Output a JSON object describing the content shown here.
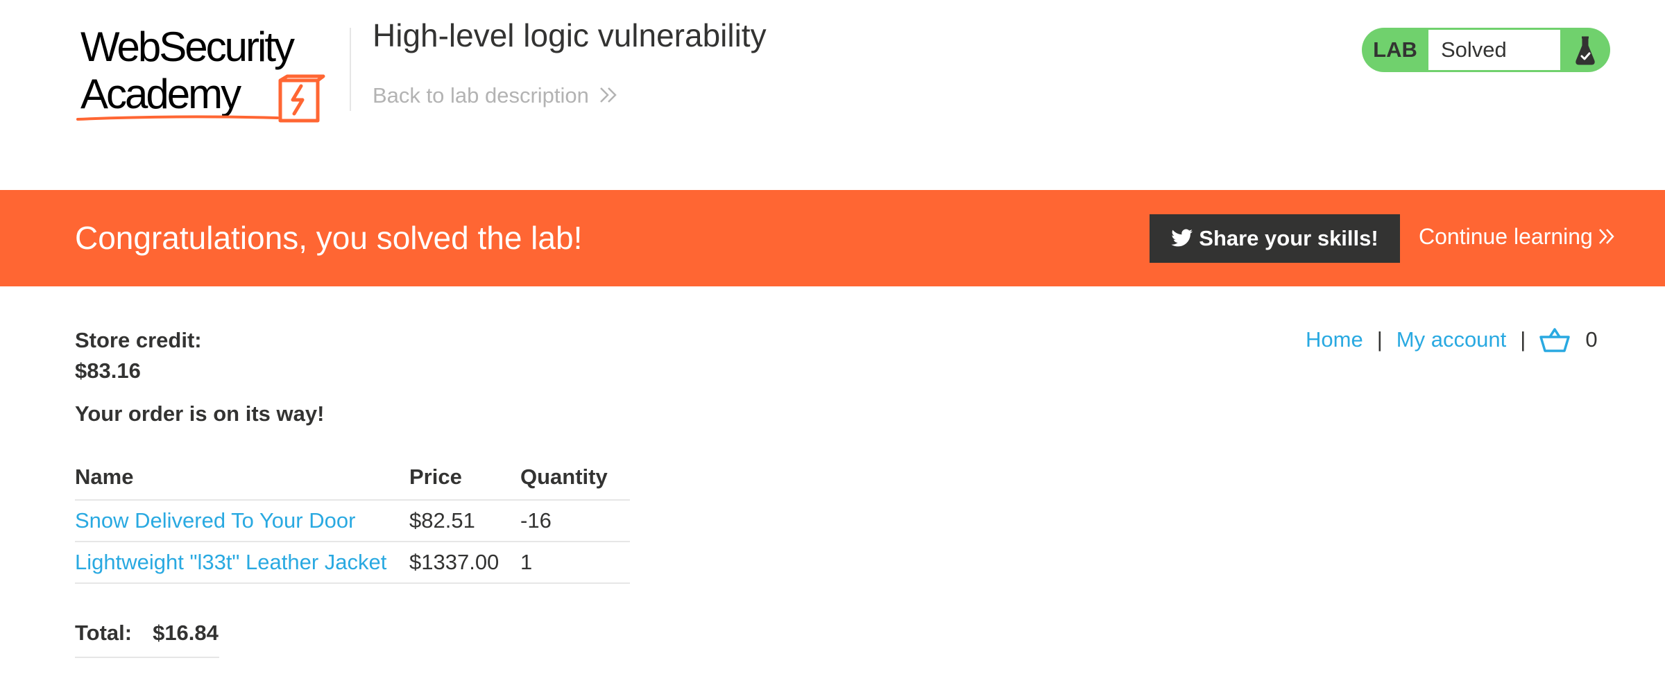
{
  "header": {
    "logo_text": "Web Security Academy",
    "lab_title": "High-level logic vulnerability",
    "back_link": "Back to lab description"
  },
  "status": {
    "tag": "LAB",
    "value": "Solved",
    "accent": "#70d16d"
  },
  "banner": {
    "message": "Congratulations, you solved the lab!",
    "share_label": "Share your skills!",
    "continue_label": "Continue learning",
    "background": "#ff6633"
  },
  "nav": {
    "home": "Home",
    "separator": "|",
    "account": "My account",
    "cart_count": "0"
  },
  "store": {
    "credit_label": "Store credit:",
    "credit_value": "$83.16",
    "order_message": "Your order is on its way!"
  },
  "order": {
    "columns": [
      "Name",
      "Price",
      "Quantity"
    ],
    "rows": [
      {
        "name": "Snow Delivered To Your Door",
        "price": "$82.51",
        "quantity": "-16"
      },
      {
        "name": "Lightweight \"l33t\" Leather Jacket",
        "price": "$1337.00",
        "quantity": "1"
      }
    ],
    "total_label": "Total:",
    "total_value": "$16.84"
  },
  "colors": {
    "link": "#29a9e1",
    "text": "#333332"
  },
  "icons": {
    "twitter": "twitter-icon",
    "cart": "shopping-basket-icon",
    "flask": "flask-icon",
    "chevron": "double-chevron-right-icon"
  }
}
